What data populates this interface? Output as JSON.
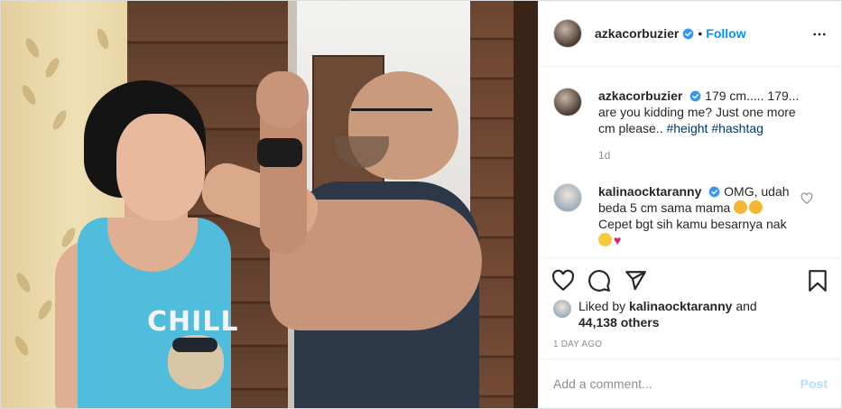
{
  "post": {
    "author": "azkacorbuzier",
    "follow_label": "Follow",
    "separator": "•",
    "caption_text": "179 cm..... 179... are you kidding me? Just one more cm please..",
    "hashtags": [
      "#height",
      "#hashtag"
    ],
    "time_ago": "1d"
  },
  "photo": {
    "shirt_text": "CHILL"
  },
  "comment": {
    "user": "kalinaocktaranny",
    "line1": "OMG, udah beda 5 cm sama mama",
    "line2": "Cepet bgt sih kamu besarnya nak",
    "emojis": [
      "tired-face-emoji",
      "tired-face-emoji",
      "rolling-eyes-emoji",
      "red-heart-emoji"
    ]
  },
  "likes": {
    "prefix": "Liked by",
    "liker": "kalinaocktaranny",
    "conj": "and",
    "count_text": "44,138 others"
  },
  "date_label": "1 DAY AGO",
  "add_comment": {
    "placeholder": "Add a comment...",
    "post_label": "Post"
  },
  "icons": [
    "verified-badge-icon",
    "more-options-icon",
    "heart-icon",
    "comment-icon",
    "share-icon",
    "save-icon",
    "like-comment-icon"
  ],
  "colors": {
    "link_blue": "#0095f6",
    "post_disabled": "#b2dffc",
    "hashtag": "#00376b",
    "muted": "#8e8e8e"
  }
}
